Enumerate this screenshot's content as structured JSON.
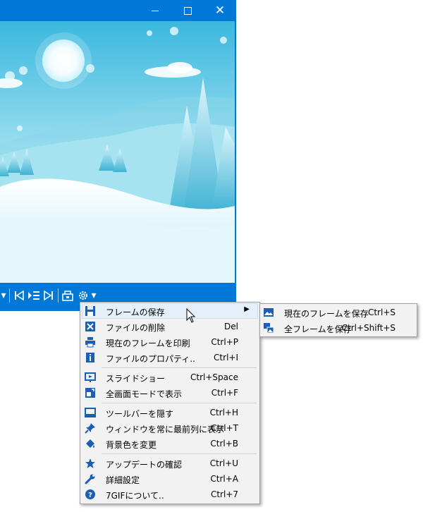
{
  "window": {
    "controls": {
      "minimize": "minimize-icon",
      "maximize": "maximize-icon",
      "close": "close-icon"
    },
    "close_glyph": "✕"
  },
  "toolbar": {
    "icons": [
      "first-frame-icon",
      "frame-list-icon",
      "last-frame-icon",
      "save-frame-icon",
      "settings-icon"
    ],
    "dropdown_glyph": "▾"
  },
  "menu": {
    "items": [
      {
        "label": "フレームの保存",
        "shortcut": "",
        "icon": "save-icon",
        "submenu": true
      },
      {
        "label": "ファイルの削除",
        "shortcut": "Del",
        "icon": "delete-icon"
      },
      {
        "label": "現在のフレームを印刷",
        "shortcut": "Ctrl+P",
        "icon": "print-icon"
      },
      {
        "label": "ファイルのプロパティ..",
        "shortcut": "Ctrl+I",
        "icon": "info-icon"
      },
      {
        "label": "スライドショー",
        "shortcut": "Ctrl+Space",
        "icon": "slideshow-icon"
      },
      {
        "label": "全画面モードで表示",
        "shortcut": "Ctrl+F",
        "icon": "fullscreen-icon"
      },
      {
        "label": "ツールバーを隠す",
        "shortcut": "Ctrl+H",
        "icon": "toolbar-icon"
      },
      {
        "label": "ウィンドウを常に最前列に表示",
        "shortcut": "Ctrl+T",
        "icon": "pin-icon"
      },
      {
        "label": "背景色を変更",
        "shortcut": "Ctrl+B",
        "icon": "paint-bucket-icon"
      },
      {
        "label": "アップデートの確認",
        "shortcut": "Ctrl+U",
        "icon": "star-icon"
      },
      {
        "label": "詳細設定",
        "shortcut": "Ctrl+A",
        "icon": "wrench-icon"
      },
      {
        "label": "7GIFについて..",
        "shortcut": "Ctrl+7",
        "icon": "help-icon"
      }
    ],
    "submenu_arrow": "▶"
  },
  "submenu": {
    "items": [
      {
        "label": "現在のフレームを保存",
        "shortcut": "Ctrl+S",
        "icon": "image-icon"
      },
      {
        "label": "全フレームを保存",
        "shortcut": "Ctrl+Shift+S",
        "icon": "images-icon"
      }
    ]
  },
  "colors": {
    "titlebar": "#0078d7",
    "menu_bg": "#f2f2f2",
    "highlight": "#e6f0fa",
    "icon_blue": "#1a5fb4"
  }
}
